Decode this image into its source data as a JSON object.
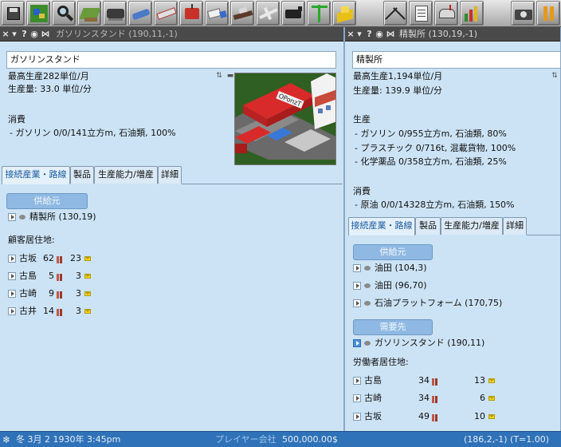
{
  "statusbar": {
    "date": "冬 3月 2 1930年  3:45pm",
    "company": "プレイヤー会社",
    "money": "500,000.00$",
    "coords": "(186,2,-1) (T=1.00)"
  },
  "left": {
    "title": "ガソリンスタンド (190,11,-1)",
    "name": "ガソリンスタンド",
    "max_production": "最高生産282単位/月",
    "production": "生産量: 33.0 単位/分",
    "consumption_heading": "消費",
    "consumption_items": [
      "- ガソリン 0/0/141立方m, 石油類, 100%"
    ],
    "tabs": [
      "接続産業・路線",
      "製品",
      "生産能力/増産",
      "詳細"
    ],
    "supplier_heading": "供給元",
    "suppliers": [
      "精製所 (130,19)"
    ],
    "residents_heading": "顧客居住地:",
    "residents": [
      {
        "name": "古坂",
        "pax": "62",
        "mail": "23"
      },
      {
        "name": "古島",
        "pax": "5",
        "mail": "3"
      },
      {
        "name": "古崎",
        "pax": "9",
        "mail": "3"
      },
      {
        "name": "古井",
        "pax": "14",
        "mail": "3"
      }
    ]
  },
  "right": {
    "title": "精製所 (130,19,-1)",
    "name": "精製所",
    "max_production": "最高生産1,194単位/月",
    "production": "生産量: 139.9 単位/分",
    "production_heading": "生産",
    "production_items": [
      "- ガソリン 0/955立方m, 石油類, 80%",
      "- プラスチック 0/716t, 混載貨物, 100%",
      "- 化学薬品 0/358立方m, 石油類, 25%"
    ],
    "consumption_heading": "消費",
    "consumption_items": [
      "- 原油 0/0/14328立方m, 石油類, 150%"
    ],
    "tabs": [
      "接続産業・路線",
      "製品",
      "生産能力/増産",
      "詳細"
    ],
    "supplier_heading": "供給元",
    "suppliers": [
      "油田 (104,3)",
      "油田 (96,70)",
      "石油プラットフォーム (170,75)"
    ],
    "consumer_heading": "需要先",
    "consumers": [
      "ガソリンスタンド (190,11)"
    ],
    "workers_heading": "労働者居住地:",
    "workers": [
      {
        "name": "古島",
        "pax": "34",
        "mail": "13"
      },
      {
        "name": "古崎",
        "pax": "34",
        "mail": "6"
      },
      {
        "name": "古坂",
        "pax": "49",
        "mail": "10"
      }
    ]
  },
  "picture_sign": "OPonzT",
  "colors": {
    "statusbar": "#2f72b8",
    "window_bg": "#cce3f5",
    "titlebar": "#4a4a4a",
    "tab_active_text": "#1a5a9e",
    "pill_head": "#8fb9e3"
  },
  "toolbar_icons": [
    "save-disk-icon",
    "map-icon",
    "zoom-magnifier-icon",
    "terrain-icon",
    "rail-train-icon",
    "road-car-icon",
    "monorail-icon",
    "tram-icon",
    "truck-icon",
    "ship-icon",
    "airplane-icon",
    "steam-engine-icon",
    "crane-icon",
    "city-build-icon",
    "tools-icon",
    "list-icon",
    "mailbox-icon",
    "finance-chart-icon",
    "screenshot-camera-icon",
    "pause-icon"
  ]
}
